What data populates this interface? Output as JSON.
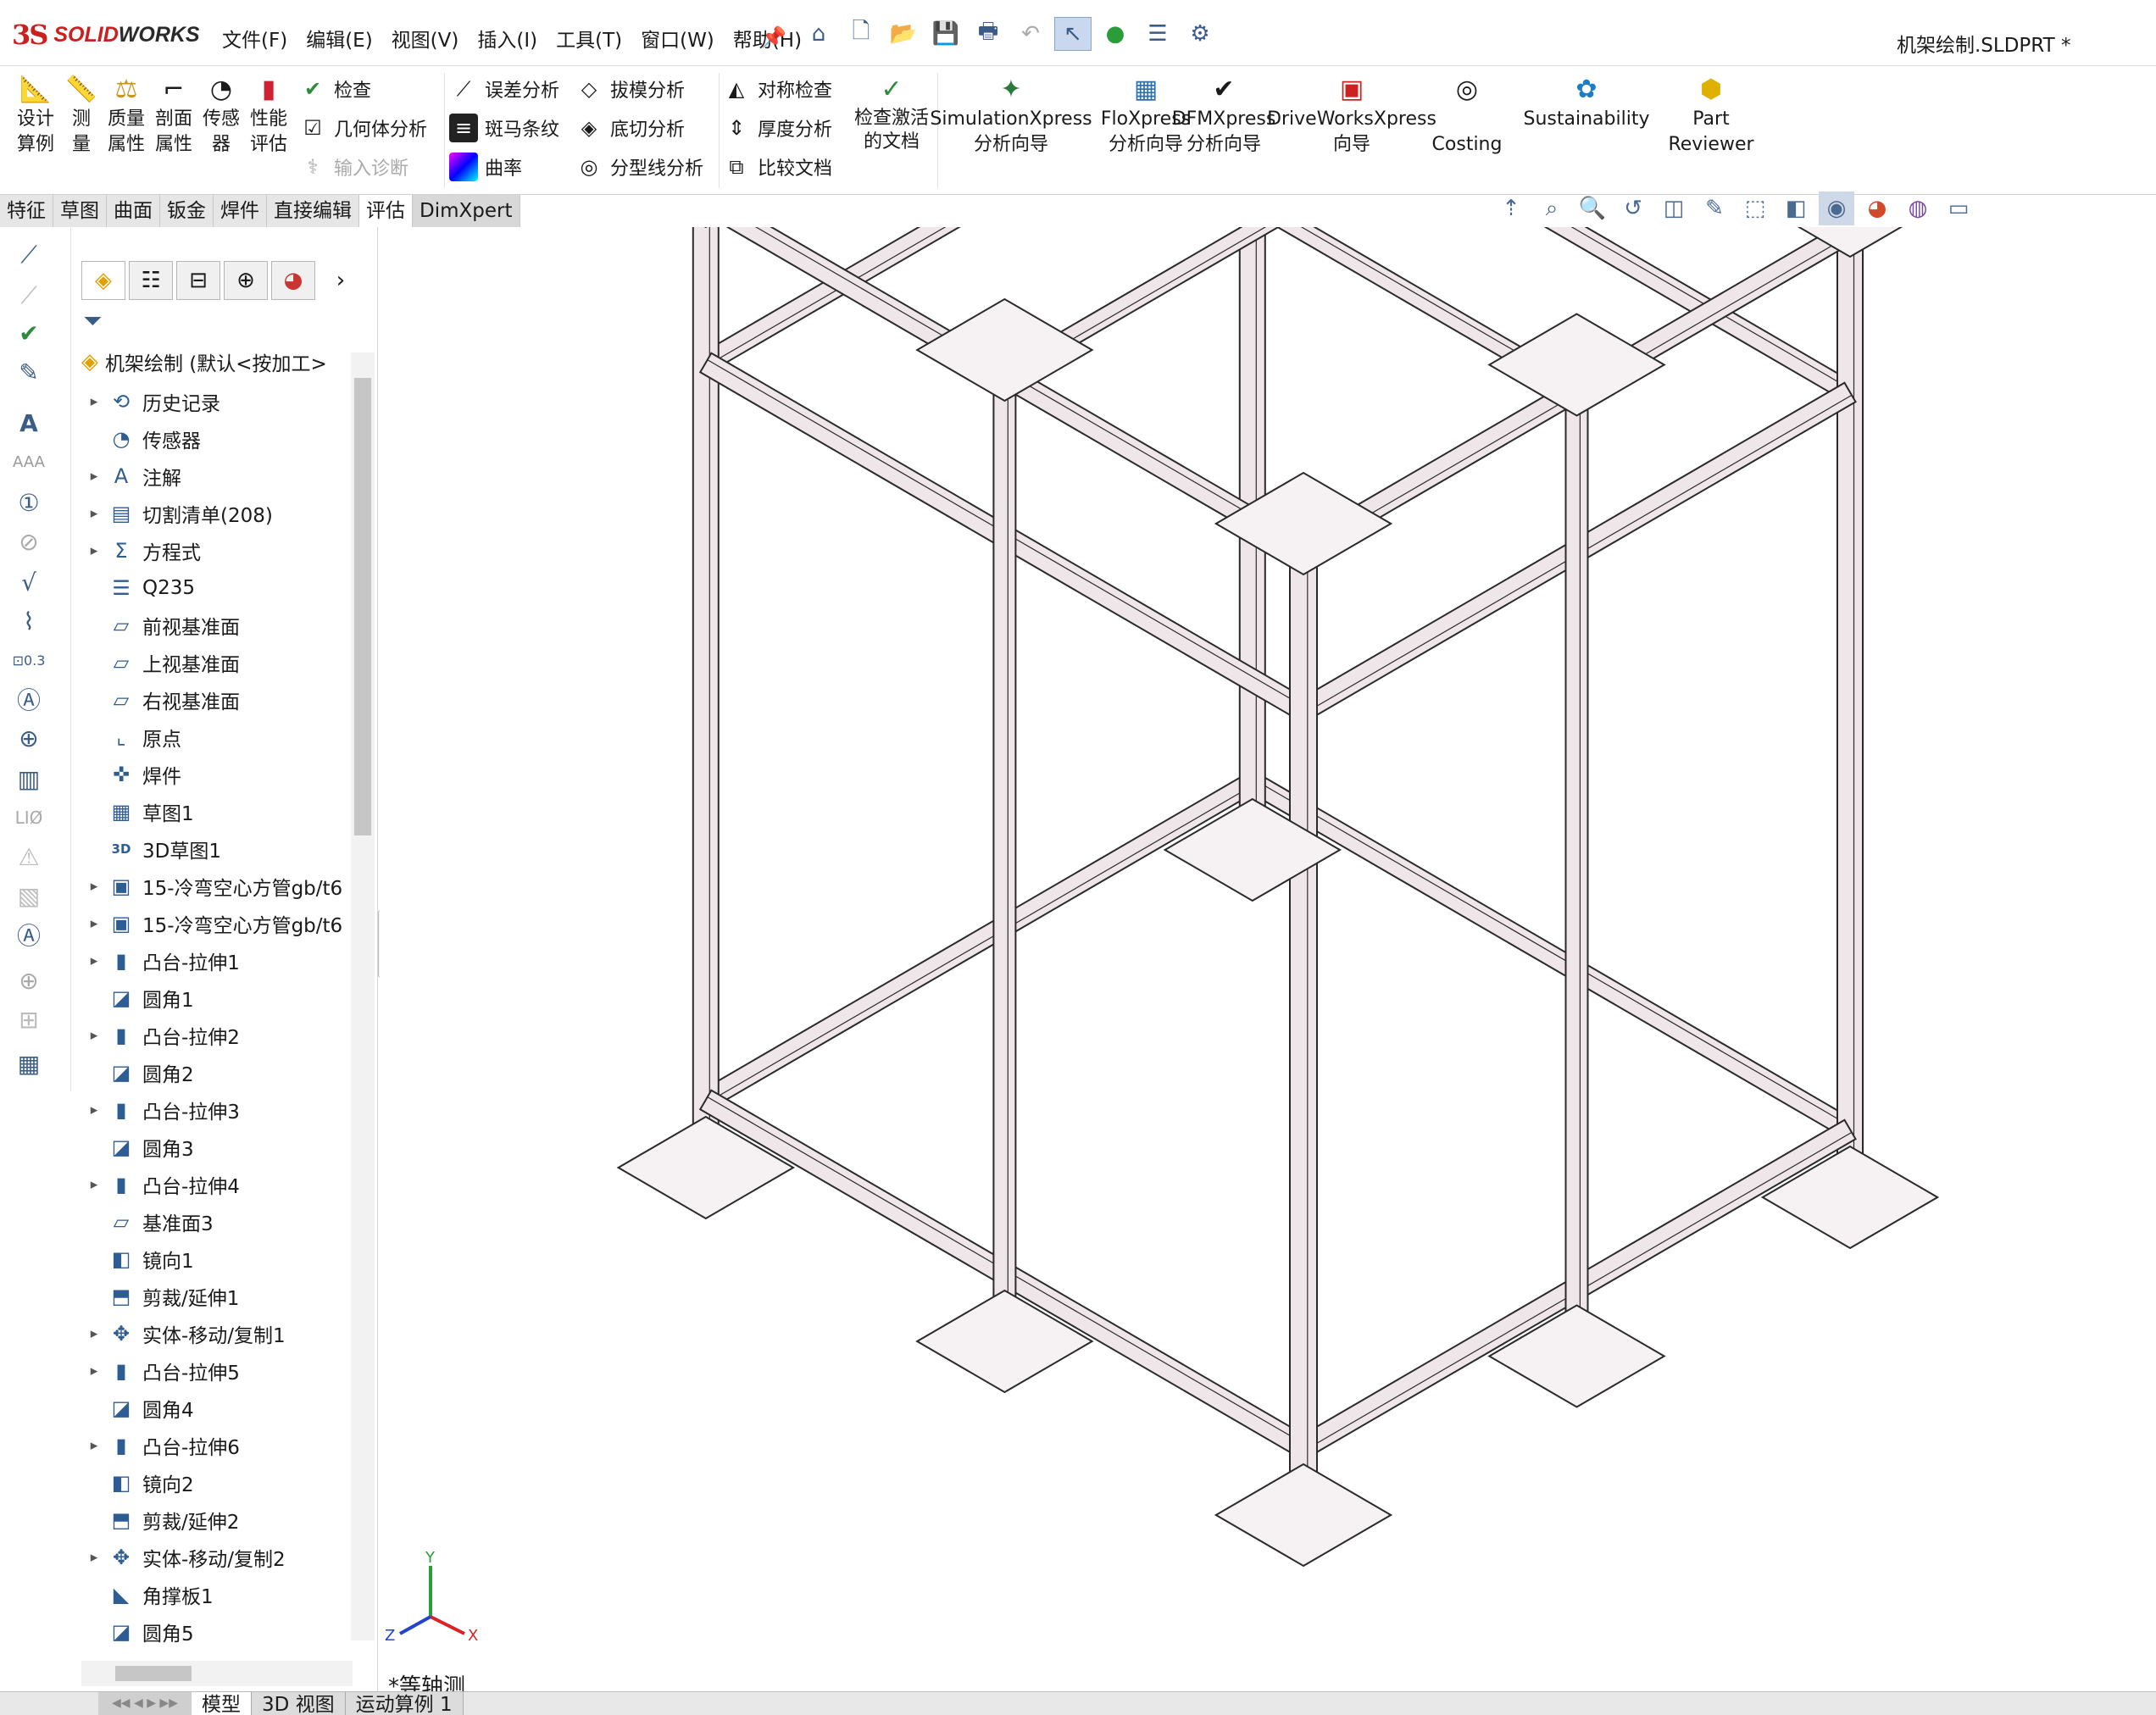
{
  "app": {
    "logo_ds": "3S",
    "logo_solid": "SOLID",
    "logo_works": "WORKS",
    "document_title": "机架绘制.SLDPRT *"
  },
  "menu": [
    "文件(F)",
    "编辑(E)",
    "视图(V)",
    "插入(I)",
    "工具(T)",
    "窗口(W)",
    "帮助(H)"
  ],
  "quick_access": [
    "home-icon",
    "new-doc-icon",
    "open-icon",
    "save-icon",
    "print-icon",
    "undo-icon",
    "select-icon",
    "rebuild-icon",
    "options-list-icon",
    "settings-icon"
  ],
  "commands": {
    "design_study": "设计\n算例",
    "measure": "测\n量",
    "mass_props": "质量\n属性",
    "section_props": "剖面\n属性",
    "sensor": "传感\n器",
    "perf_eval": "性能\n评估",
    "check": "检查",
    "geometry_analysis": "几何体分析",
    "import_diag": "输入诊断",
    "deviation": "误差分析",
    "zebra": "斑马条纹",
    "curvature": "曲率",
    "draft": "拔模分析",
    "undercut": "底切分析",
    "parting_line": "分型线分析",
    "symmetry": "对称检查",
    "thickness": "厚度分析",
    "compare": "比较文档",
    "check_active": "检查激活\n的文档",
    "simxpress": "SimulationXpress\n分析向导",
    "floxpress": "FloXpress\n分析向导",
    "dfmxpress": "DFMXpress\n分析向导",
    "driveworks": "DriveWorksXpress\n向导",
    "costing": "Costing",
    "sustainability": "Sustainability",
    "part_reviewer": "Part\nReviewer"
  },
  "tabs": [
    "特征",
    "草图",
    "曲面",
    "钣金",
    "焊件",
    "直接编辑",
    "评估",
    "DimXpert"
  ],
  "active_tab": "评估",
  "tree": {
    "root": "机架绘制 (默认<按加工>",
    "items": [
      {
        "label": "历史记录",
        "icon": "history-icon",
        "arrow": true
      },
      {
        "label": "传感器",
        "icon": "sensor-icon",
        "arrow": false
      },
      {
        "label": "注解",
        "icon": "annotation-icon",
        "arrow": true
      },
      {
        "label": "切割清单(208)",
        "icon": "cut-list-icon",
        "arrow": true
      },
      {
        "label": "方程式",
        "icon": "equation-icon",
        "arrow": true
      },
      {
        "label": "Q235",
        "icon": "material-icon",
        "arrow": false
      },
      {
        "label": "前视基准面",
        "icon": "plane-icon",
        "arrow": false
      },
      {
        "label": "上视基准面",
        "icon": "plane-icon",
        "arrow": false
      },
      {
        "label": "右视基准面",
        "icon": "plane-icon",
        "arrow": false
      },
      {
        "label": "原点",
        "icon": "origin-icon",
        "arrow": false
      },
      {
        "label": "焊件",
        "icon": "weldment-icon",
        "arrow": false
      },
      {
        "label": "草图1",
        "icon": "sketch-icon",
        "arrow": false
      },
      {
        "label": "3D草图1",
        "icon": "3d-sketch-icon",
        "arrow": false
      },
      {
        "label": "15-冷弯空心方管gb/t6",
        "icon": "structural-member-icon",
        "arrow": true
      },
      {
        "label": "15-冷弯空心方管gb/t6",
        "icon": "structural-member-icon",
        "arrow": true
      },
      {
        "label": "凸台-拉伸1",
        "icon": "extrude-icon",
        "arrow": true
      },
      {
        "label": "圆角1",
        "icon": "fillet-icon",
        "arrow": false
      },
      {
        "label": "凸台-拉伸2",
        "icon": "extrude-icon",
        "arrow": true
      },
      {
        "label": "圆角2",
        "icon": "fillet-icon",
        "arrow": false
      },
      {
        "label": "凸台-拉伸3",
        "icon": "extrude-icon",
        "arrow": true
      },
      {
        "label": "圆角3",
        "icon": "fillet-icon",
        "arrow": false
      },
      {
        "label": "凸台-拉伸4",
        "icon": "extrude-icon",
        "arrow": true
      },
      {
        "label": "基准面3",
        "icon": "plane-icon",
        "arrow": false
      },
      {
        "label": "镜向1",
        "icon": "mirror-icon",
        "arrow": false
      },
      {
        "label": "剪裁/延伸1",
        "icon": "trim-extend-icon",
        "arrow": false
      },
      {
        "label": "实体-移动/复制1",
        "icon": "move-copy-icon",
        "arrow": true
      },
      {
        "label": "凸台-拉伸5",
        "icon": "extrude-icon",
        "arrow": true
      },
      {
        "label": "圆角4",
        "icon": "fillet-icon",
        "arrow": false
      },
      {
        "label": "凸台-拉伸6",
        "icon": "extrude-icon",
        "arrow": true
      },
      {
        "label": "镜向2",
        "icon": "mirror-icon",
        "arrow": false
      },
      {
        "label": "剪裁/延伸2",
        "icon": "trim-extend-icon",
        "arrow": false
      },
      {
        "label": "实体-移动/复制2",
        "icon": "move-copy-icon",
        "arrow": true
      },
      {
        "label": "角撑板1",
        "icon": "gusset-icon",
        "arrow": false
      },
      {
        "label": "圆角5",
        "icon": "fillet-icon",
        "arrow": false
      }
    ]
  },
  "viewport": {
    "view_label": "*等轴测",
    "triad": {
      "x": "X",
      "y": "Y",
      "z": "Z"
    },
    "frame_color": "#efe6ea",
    "edge_color": "#2a2a2a"
  },
  "bottom_tabs": [
    "模型",
    "3D 视图",
    "运动算例 1"
  ],
  "active_bottom_tab": "模型"
}
